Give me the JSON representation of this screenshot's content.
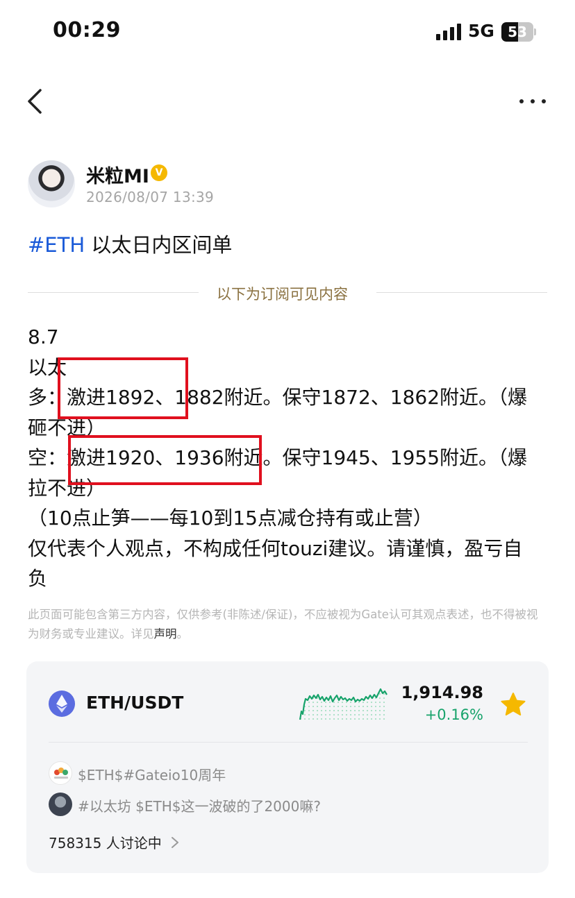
{
  "status_bar": {
    "time": "00:29",
    "network": "5G",
    "battery": "53",
    "battery_level": 0.53
  },
  "nav": {
    "back_icon": "chevron-left-icon",
    "more_icon": "more-horizontal-icon"
  },
  "author": {
    "name": "米粒MI",
    "verified_badge": "V",
    "timestamp": "2026/08/07 13:39"
  },
  "post": {
    "tag": "#ETH",
    "title": " 以太日内区间单",
    "subscription_divider": "以下为订阅可见内容",
    "lines": [
      "8.7",
      "以太",
      "多：激进1892、1882附近。保守1872、1862附近。（爆",
      "砸不进）",
      "空：激进1920、1936附近。保守1945、1955附近。（爆",
      "拉不进）",
      "（10点止笋——每10到15点减仓持有或止营）",
      "仅代表个人观点，不构成任何touzi建议。请谨慎，盈亏自",
      "负"
    ]
  },
  "disclaimer": {
    "text": "此页面可能包含第三方内容，仅供参考(非陈述/保证)，不应被视为Gate认可其观点表述，也不得被视为财务或专业建议。详见",
    "link": "声明",
    "end": "。"
  },
  "market_card": {
    "pair": "ETH/USDT",
    "price": "1,914.98",
    "change": "+0.16%",
    "change_color": "#17a36b",
    "coin_icon": "ethereum-icon",
    "favorite_icon": "star-icon",
    "favorite_color": "#f5b800",
    "topics": [
      "$ETH$#Gateio10周年",
      "#以太坊 $ETH$这一波破的了2000嘛?"
    ],
    "discussion": "758315 人讨论中"
  }
}
